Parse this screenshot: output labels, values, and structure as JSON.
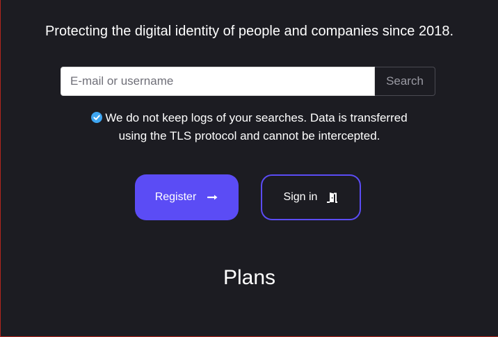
{
  "tagline": "Protecting the digital identity of people and companies since 2018.",
  "search": {
    "placeholder": "E-mail or username",
    "value": "",
    "button_label": "Search"
  },
  "notice": {
    "line1": "We do not keep logs of your searches. Data is transferred",
    "line2": "using the TLS protocol and cannot be intercepted.",
    "icon": "check-circle-icon"
  },
  "actions": {
    "register_label": "Register",
    "register_icon": "arrow-right-icon",
    "signin_label": "Sign in",
    "signin_icon": "door-enter-icon"
  },
  "plans": {
    "heading": "Plans"
  },
  "colors": {
    "background": "#1c1c22",
    "accent": "#5b4cf5",
    "check": "#3ea6f2",
    "text": "#ffffff"
  }
}
